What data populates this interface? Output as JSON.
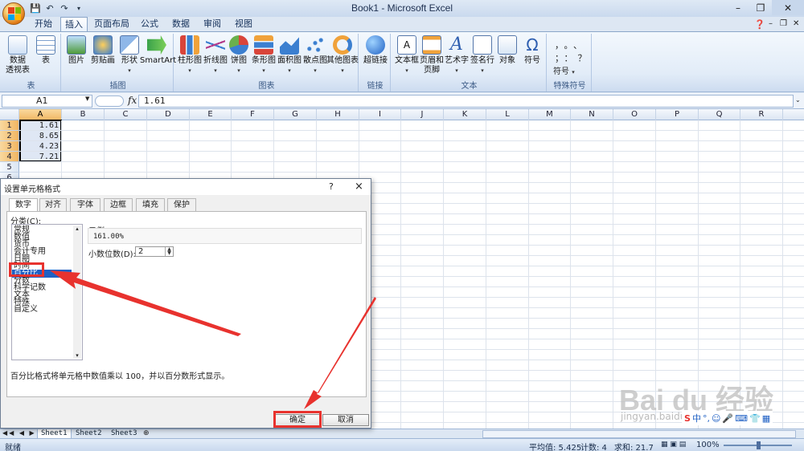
{
  "window": {
    "title": "Book1 - Microsoft Excel",
    "controls": [
      "minimize-icon",
      "restore-icon",
      "close-icon"
    ]
  },
  "ribbon": {
    "tabs": [
      "开始",
      "插入",
      "页面布局",
      "公式",
      "数据",
      "审阅",
      "视图"
    ],
    "active_tab": "插入",
    "groups": [
      {
        "label": "表",
        "buttons": [
          "数据\n透视表",
          "表"
        ]
      },
      {
        "label": "插图",
        "buttons": [
          "图片",
          "剪贴画",
          "形状",
          "SmartArt"
        ]
      },
      {
        "label": "图表",
        "buttons": [
          "柱形图",
          "折线图",
          "饼图",
          "条形图",
          "面积图",
          "散点图",
          "其他图表"
        ]
      },
      {
        "label": "链接",
        "buttons": [
          "超链接"
        ]
      },
      {
        "label": "文本",
        "buttons": [
          "文本框",
          "页眉和\n页脚",
          "艺术字",
          "签名行",
          "对象",
          "符号"
        ]
      },
      {
        "label": "特殊符号",
        "buttons": [
          "符号"
        ]
      }
    ],
    "special_symbols": [
      "，",
      "。",
      "、",
      "；",
      "：",
      "？"
    ]
  },
  "formula_bar": {
    "name_box": "A1",
    "fx": "fx",
    "value": "1.61"
  },
  "sheet": {
    "columns": [
      "A",
      "B",
      "C",
      "D",
      "E",
      "F",
      "G",
      "H",
      "I",
      "J",
      "K",
      "L",
      "M",
      "N",
      "O",
      "P",
      "Q",
      "R"
    ],
    "rows": [
      "1",
      "2",
      "3",
      "4",
      "5",
      "6"
    ],
    "cells": {
      "A1": "1.61",
      "A2": "8.65",
      "A3": "4.23",
      "A4": "7.21"
    }
  },
  "sheet_tabs": [
    "Sheet1",
    "Sheet2",
    "Sheet3"
  ],
  "status_bar": {
    "left": "就绪",
    "average": "平均值: 5.425",
    "count": "计数: 4",
    "sum": "求和: 21.7",
    "zoom": "100%"
  },
  "dialog": {
    "title": "设置单元格格式",
    "help": "?",
    "close": "×",
    "tabs": [
      "数字",
      "对齐",
      "字体",
      "边框",
      "填充",
      "保护"
    ],
    "active_tab": "数字",
    "category_label": "分类(C):",
    "categories": [
      "常规",
      "数值",
      "货币",
      "会计专用",
      "日期",
      "时间",
      "百分比",
      "分数",
      "科学记数",
      "文本",
      "特殊",
      "自定义"
    ],
    "selected_category": "百分比",
    "sample_label": "示例",
    "sample_value": "161.00%",
    "decimal_label": "小数位数(D):",
    "decimal_value": "2",
    "description": "百分比格式将单元格中数值乘以 100，并以百分数形式显示。",
    "ok": "确定",
    "cancel": "取消"
  },
  "watermark": {
    "text": "Bai du 经验",
    "sub": "jingyan.baidu.com"
  },
  "colors": {
    "accent_red": "#e8322e",
    "selection_blue": "#1f60c4",
    "ribbon_bg": "#dde7f3"
  }
}
